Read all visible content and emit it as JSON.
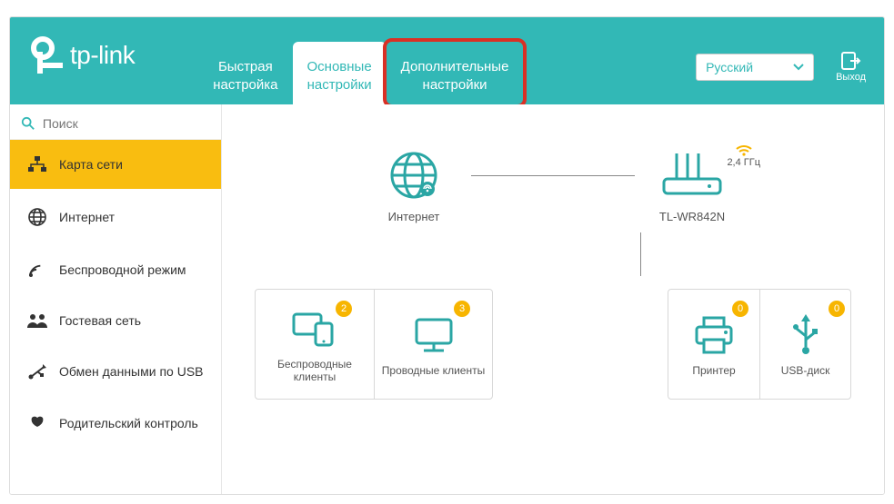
{
  "brand": "tp-link",
  "tabs": {
    "quick": "Быстрая\nнастройка",
    "basic": "Основные\nнастройки",
    "advanced": "Дополнительные\nнастройки"
  },
  "language": {
    "selected": "Русский"
  },
  "logout": "Выход",
  "search": {
    "placeholder": "Поиск"
  },
  "sidebar": {
    "items": [
      {
        "label": "Карта сети"
      },
      {
        "label": "Интернет"
      },
      {
        "label": "Беспроводной режим"
      },
      {
        "label": "Гостевая сеть"
      },
      {
        "label": "Обмен данными по USB"
      },
      {
        "label": "Родительский контроль"
      }
    ]
  },
  "topology": {
    "internet": "Интернет",
    "router_model": "TL-WR842N",
    "wifi_band": "2,4 ГГц",
    "cards": {
      "wireless_clients": {
        "label": "Беспроводные клиенты",
        "count": "2"
      },
      "wired_clients": {
        "label": "Проводные клиенты",
        "count": "3"
      },
      "printer": {
        "label": "Принтер",
        "count": "0"
      },
      "usb_disk": {
        "label": "USB-диск",
        "count": "0"
      }
    }
  }
}
